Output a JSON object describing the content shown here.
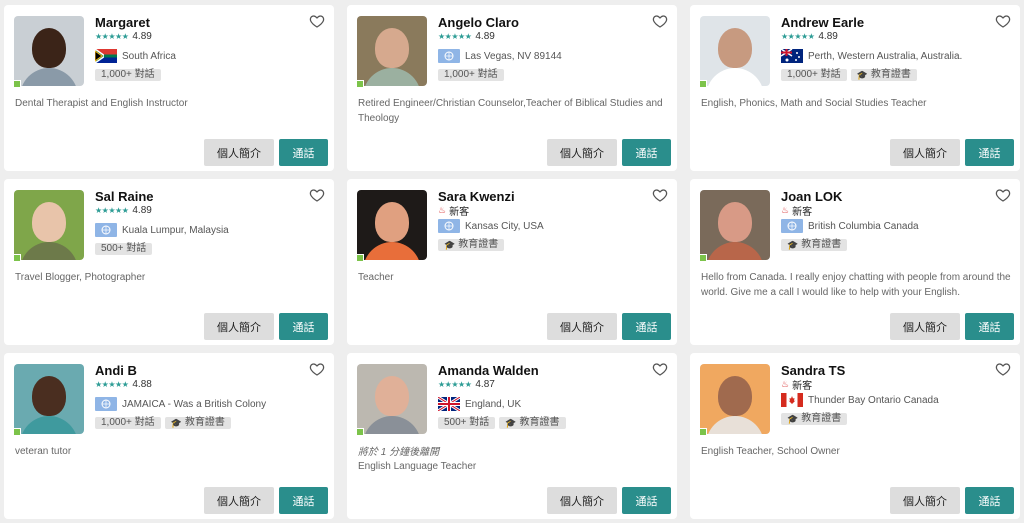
{
  "ui": {
    "profile_label": "個人簡介",
    "call_label": "通話",
    "new_label": "新客",
    "cert_label": "教育證書"
  },
  "tutors": [
    {
      "name": "Margaret",
      "rating": "4.89",
      "location": "South Africa",
      "flag": "za",
      "calls": "1,000+ 對話",
      "cert": false,
      "desc": "Dental Therapist and English Instructor",
      "skin": "#3b2418",
      "shirt": "#8a9aa8",
      "bg": "#c9cfd4"
    },
    {
      "name": "Angelo Claro",
      "rating": "4.89",
      "location": "Las Vegas, NV 89144",
      "flag": "un",
      "calls": "1,000+ 對話",
      "cert": false,
      "desc": "Retired Engineer/Christian Counselor,Teacher of Biblical Studies and Theology",
      "skin": "#d6a98e",
      "shirt": "#9bb0a0",
      "bg": "#8a7a5c"
    },
    {
      "name": "Andrew Earle",
      "rating": "4.89",
      "location": "Perth, Western Australia, Australia.",
      "flag": "au",
      "calls": "1,000+ 對話",
      "cert": true,
      "desc": "English, Phonics, Math and Social Studies Teacher",
      "skin": "#c79a80",
      "shirt": "#ffffff",
      "bg": "#dfe4e8"
    },
    {
      "name": "Sal Raine",
      "rating": "4.89",
      "location": "Kuala Lumpur, Malaysia",
      "flag": "un",
      "calls": "500+ 對話",
      "cert": false,
      "desc": "Travel Blogger, Photographer",
      "skin": "#e8c4aa",
      "shirt": "#6d7a4a",
      "bg": "#7fa64a"
    },
    {
      "name": "Sara Kwenzi",
      "location": "Kansas City, USA",
      "flag": "un",
      "cert": true,
      "desc": "Teacher",
      "skin": "#e0a080",
      "shirt": "#e86e3a",
      "bg": "#1e1a18"
    },
    {
      "name": "Joan LOK",
      "location": "British Columbia Canada",
      "flag": "un",
      "cert": true,
      "desc": "Hello from Canada. I really enjoy chatting with people from around the world. Give me a call I would like to help with your English.",
      "skin": "#d89a86",
      "shirt": "#b8664a",
      "bg": "#7a6a5a"
    },
    {
      "name": "Andi B",
      "rating": "4.88",
      "location": "JAMAICA - Was a British Colony",
      "flag": "un",
      "calls": "1,000+ 對話",
      "cert": true,
      "desc": "veteran tutor",
      "skin": "#4a2e20",
      "shirt": "#3f9a9e",
      "bg": "#6aaab0"
    },
    {
      "name": "Amanda Walden",
      "rating": "4.87",
      "location": "England, UK",
      "flag": "uk",
      "calls": "500+ 對話",
      "cert": true,
      "note": "將於 1 分鐘後離開",
      "desc": "English Language Teacher",
      "skin": "#e0b098",
      "shirt": "#8a9098",
      "bg": "#bcb8b0"
    },
    {
      "name": "Sandra TS",
      "location": "Thunder Bay Ontario Canada",
      "flag": "ca",
      "cert": true,
      "desc": "English Teacher, School Owner",
      "skin": "#a06a4e",
      "shirt": "#e8e0d8",
      "bg": "#f0a860"
    }
  ]
}
